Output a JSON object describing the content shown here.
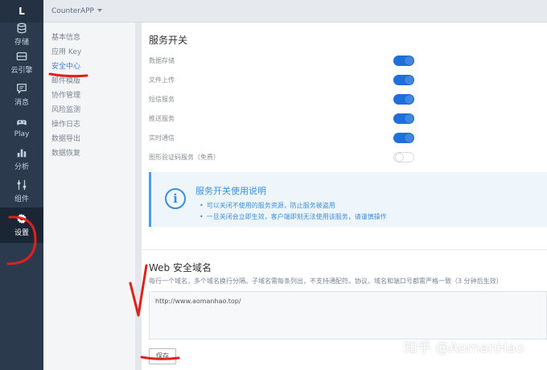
{
  "rail": {
    "logo": "L",
    "items": [
      {
        "label": "存储",
        "icon": "database-icon"
      },
      {
        "label": "云引擎",
        "icon": "server-icon"
      },
      {
        "label": "消息",
        "icon": "message-icon"
      },
      {
        "label": "Play",
        "icon": "gamepad-icon"
      },
      {
        "label": "分析",
        "icon": "bar-chart-icon"
      },
      {
        "label": "组件",
        "icon": "sliders-icon"
      },
      {
        "label": "设置",
        "icon": "gear-icon"
      }
    ]
  },
  "topbar": {
    "app_name": "CounterAPP"
  },
  "submenu": {
    "items": [
      "基本信息",
      "应用 Key",
      "安全中心",
      "邮件模版",
      "协作管理",
      "风险监测",
      "操作日志",
      "数据导出",
      "数据恢复"
    ]
  },
  "switches": {
    "title": "服务开关",
    "items": [
      {
        "label": "数据存储",
        "on": true
      },
      {
        "label": "文件上传",
        "on": true
      },
      {
        "label": "短信服务",
        "on": true
      },
      {
        "label": "推送服务",
        "on": true
      },
      {
        "label": "实时通信",
        "on": true
      },
      {
        "label": "图形验证码服务（免费）",
        "on": false
      }
    ]
  },
  "info": {
    "title": "服务开关使用说明",
    "lines": [
      "可以关闭不使用的服务资源，防止服务被盗用",
      "一旦关闭会立即生效，客户端即刻无法使用该服务，请谨慎操作"
    ]
  },
  "domain": {
    "title": "Web 安全域名",
    "hint": "每行一个域名，多个域名换行分隔。子域名需每条列出，不支持通配符。协议、域名和端口号都需严格一致（3 分钟后生效）",
    "value": "http://www.aomanhao.top/",
    "save_label": "保存"
  },
  "watermark": "知乎 @AomanHao",
  "colors": {
    "accent": "#3d7fd6",
    "toggle_on": "#1e6fd9",
    "annotation": "#e0201b",
    "rail": "#2b3a4d"
  }
}
